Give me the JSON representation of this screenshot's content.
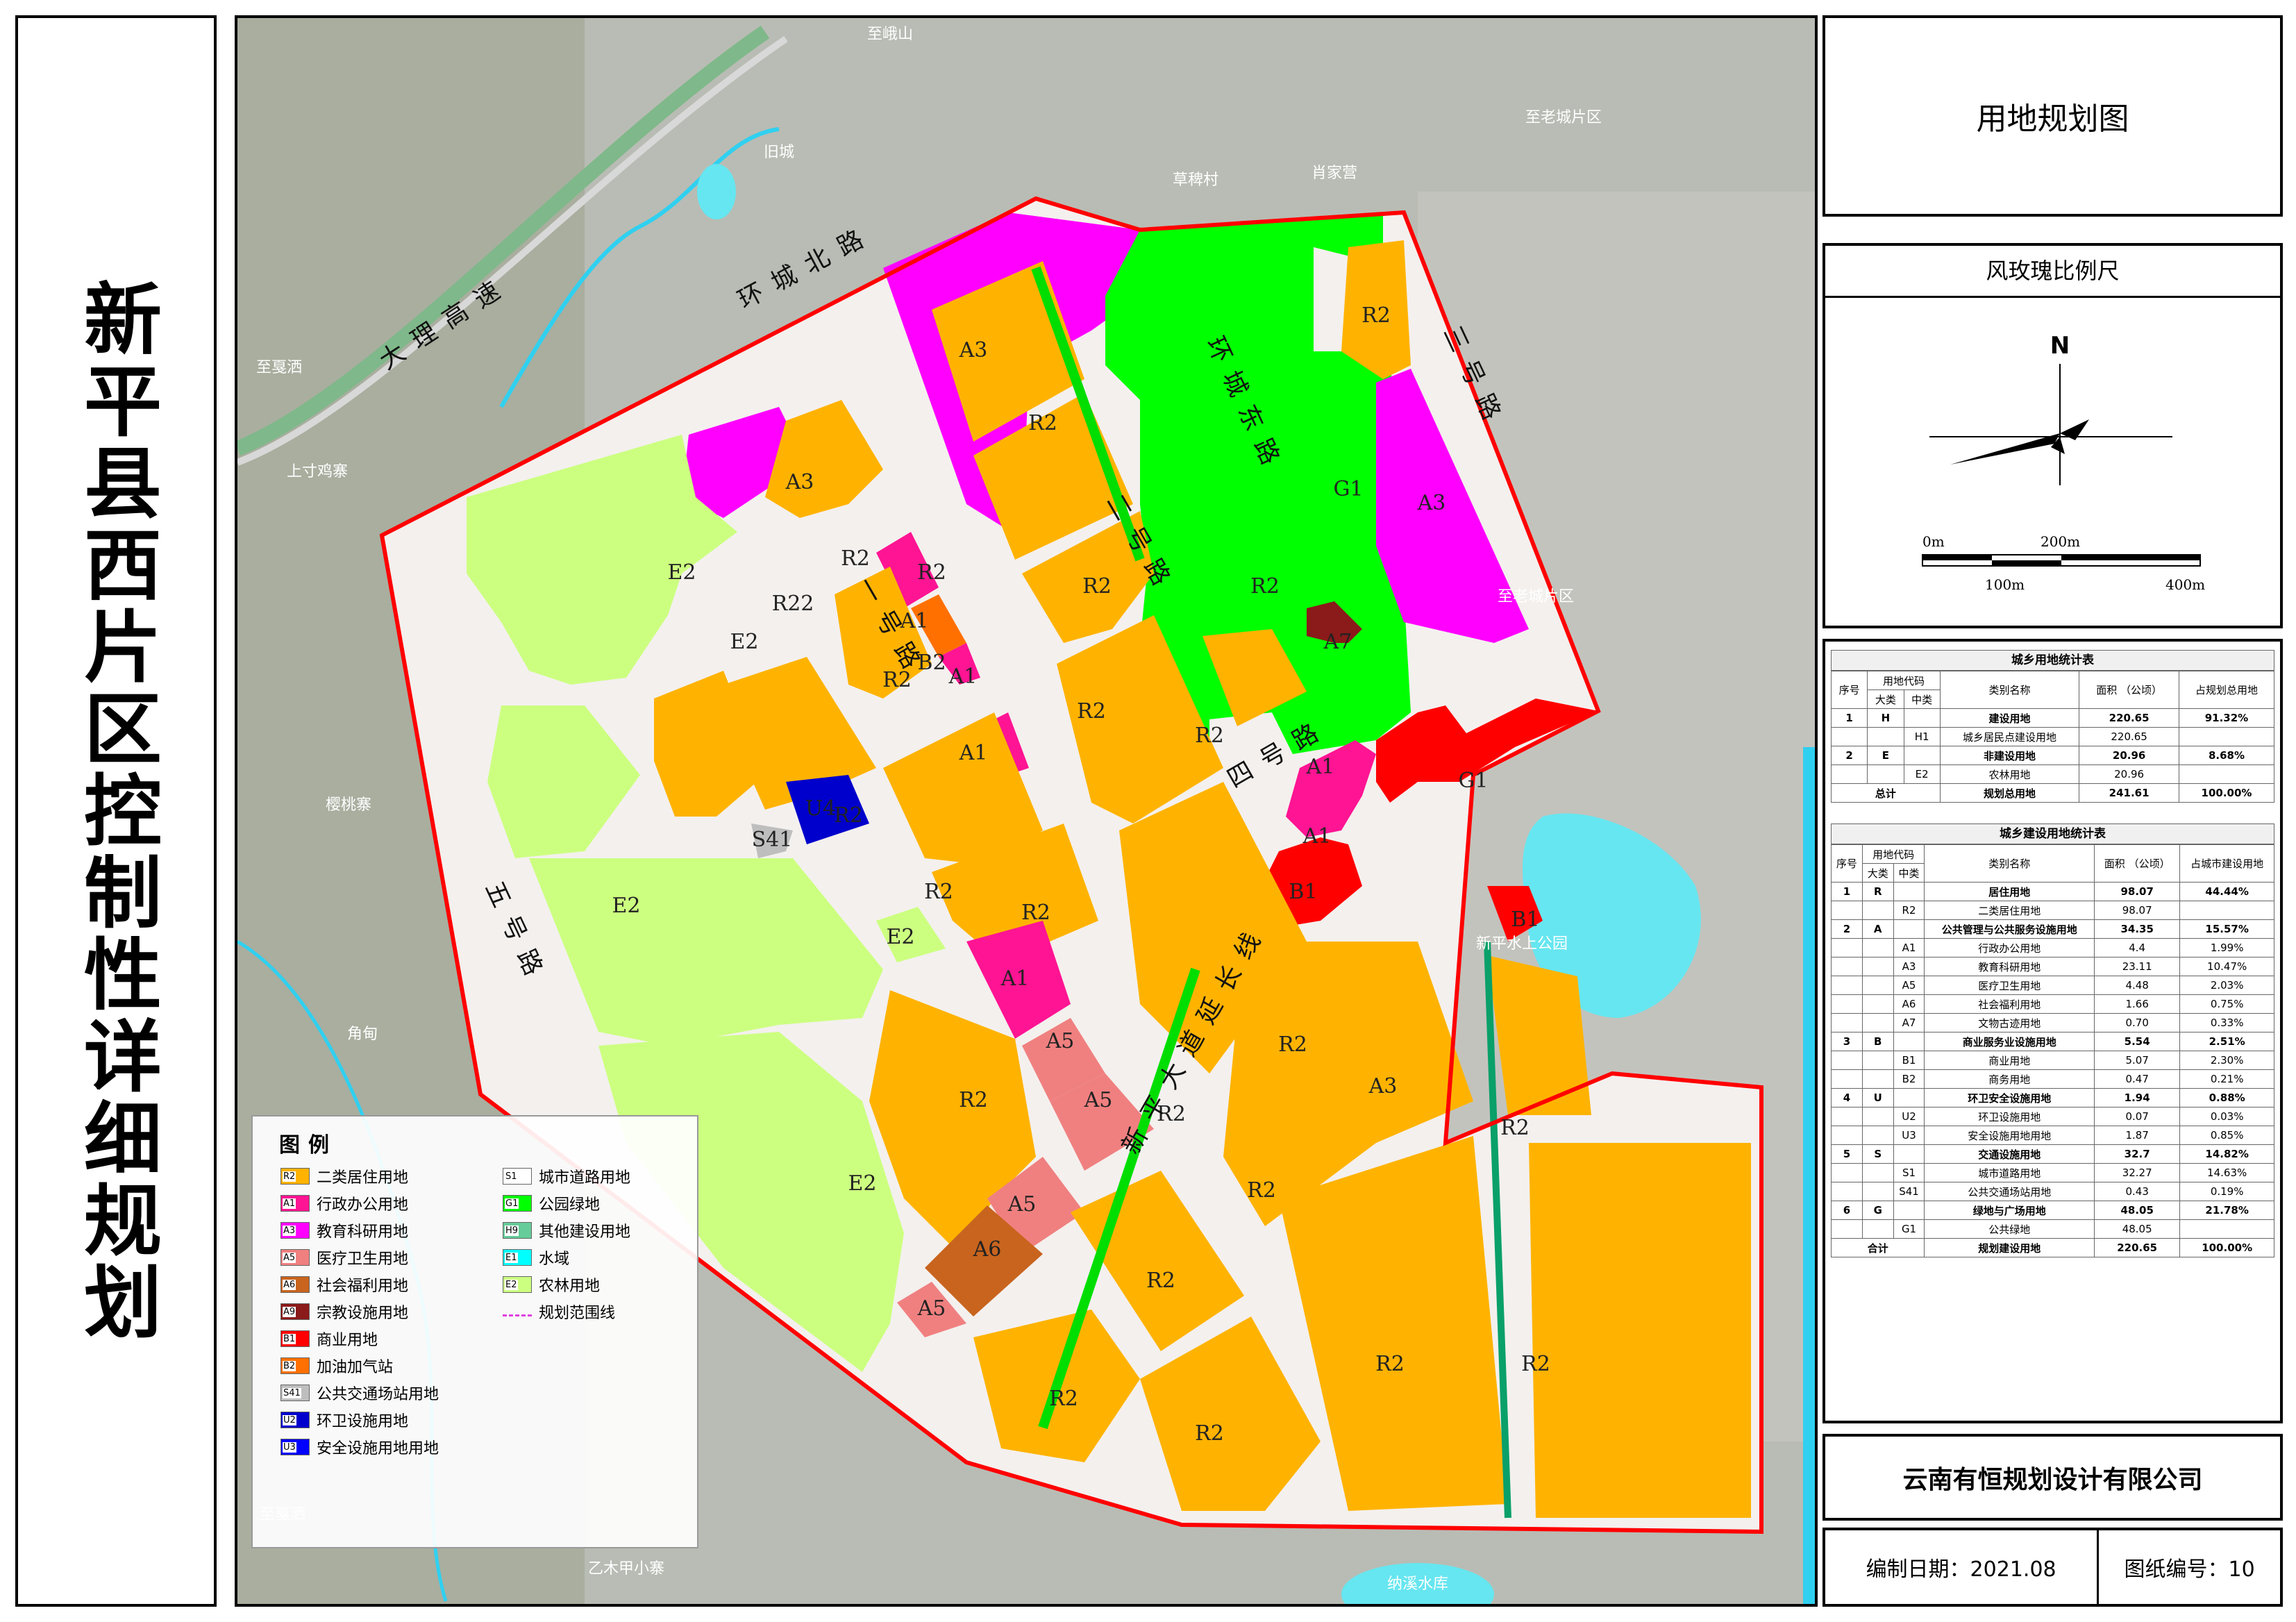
{
  "side_title": "新平县西片区控制性详细规划",
  "map_title": "用地规划图",
  "compass": {
    "header": "风玫瑰比例尺",
    "north": "N",
    "scale_labels": [
      "0m",
      "200m",
      "100m",
      "400m"
    ]
  },
  "stats1": {
    "caption": "城乡用地统计表",
    "headers": [
      "序号",
      "用地代码",
      "大类",
      "中类",
      "类别名称",
      "面积 （公顷）",
      "占规划总用地"
    ],
    "rows": [
      {
        "no": "1",
        "major": "H",
        "minor": "",
        "name": "建设用地",
        "area": "220.65",
        "pct": "91.32%",
        "bold": true
      },
      {
        "no": "",
        "major": "",
        "minor": "H1",
        "name": "城乡居民点建设用地",
        "area": "220.65",
        "pct": "",
        "bold": false
      },
      {
        "no": "2",
        "major": "E",
        "minor": "",
        "name": "非建设用地",
        "area": "20.96",
        "pct": "8.68%",
        "bold": true
      },
      {
        "no": "",
        "major": "",
        "minor": "E2",
        "name": "农林用地",
        "area": "20.96",
        "pct": "",
        "bold": false
      }
    ],
    "total": {
      "label": "总计",
      "name": "规划总用地",
      "area": "241.61",
      "pct": "100.00%"
    }
  },
  "stats2": {
    "caption": "城乡建设用地统计表",
    "headers": [
      "序号",
      "用地代码",
      "大类",
      "中类",
      "类别名称",
      "面积 （公顷）",
      "占城市建设用地"
    ],
    "rows": [
      {
        "no": "1",
        "major": "R",
        "minor": "",
        "name": "居住用地",
        "area": "98.07",
        "pct": "44.44%",
        "bold": true
      },
      {
        "no": "",
        "major": "",
        "minor": "R2",
        "name": "二类居住用地",
        "area": "98.07",
        "pct": "",
        "bold": false
      },
      {
        "no": "2",
        "major": "A",
        "minor": "",
        "name": "公共管理与公共服务设施用地",
        "area": "34.35",
        "pct": "15.57%",
        "bold": true
      },
      {
        "no": "",
        "major": "",
        "minor": "A1",
        "name": "行政办公用地",
        "area": "4.4",
        "pct": "1.99%",
        "bold": false
      },
      {
        "no": "",
        "major": "",
        "minor": "A3",
        "name": "教育科研用地",
        "area": "23.11",
        "pct": "10.47%",
        "bold": false
      },
      {
        "no": "",
        "major": "",
        "minor": "A5",
        "name": "医疗卫生用地",
        "area": "4.48",
        "pct": "2.03%",
        "bold": false
      },
      {
        "no": "",
        "major": "",
        "minor": "A6",
        "name": "社会福利用地",
        "area": "1.66",
        "pct": "0.75%",
        "bold": false
      },
      {
        "no": "",
        "major": "",
        "minor": "A7",
        "name": "文物古迹用地",
        "area": "0.70",
        "pct": "0.33%",
        "bold": false
      },
      {
        "no": "3",
        "major": "B",
        "minor": "",
        "name": "商业服务业设施用地",
        "area": "5.54",
        "pct": "2.51%",
        "bold": true
      },
      {
        "no": "",
        "major": "",
        "minor": "B1",
        "name": "商业用地",
        "area": "5.07",
        "pct": "2.30%",
        "bold": false
      },
      {
        "no": "",
        "major": "",
        "minor": "B2",
        "name": "商务用地",
        "area": "0.47",
        "pct": "0.21%",
        "bold": false
      },
      {
        "no": "4",
        "major": "U",
        "minor": "",
        "name": "环卫安全设施用地",
        "area": "1.94",
        "pct": "0.88%",
        "bold": true
      },
      {
        "no": "",
        "major": "",
        "minor": "U2",
        "name": "环卫设施用地",
        "area": "0.07",
        "pct": "0.03%",
        "bold": false
      },
      {
        "no": "",
        "major": "",
        "minor": "U3",
        "name": "安全设施用地用地",
        "area": "1.87",
        "pct": "0.85%",
        "bold": false
      },
      {
        "no": "5",
        "major": "S",
        "minor": "",
        "name": "交通设施用地",
        "area": "32.7",
        "pct": "14.82%",
        "bold": true
      },
      {
        "no": "",
        "major": "",
        "minor": "S1",
        "name": "城市道路用地",
        "area": "32.27",
        "pct": "14.63%",
        "bold": false
      },
      {
        "no": "",
        "major": "",
        "minor": "S41",
        "name": "公共交通场站用地",
        "area": "0.43",
        "pct": "0.19%",
        "bold": false
      },
      {
        "no": "6",
        "major": "G",
        "minor": "",
        "name": "绿地与广场用地",
        "area": "48.05",
        "pct": "21.78%",
        "bold": true
      },
      {
        "no": "",
        "major": "",
        "minor": "G1",
        "name": "公共绿地",
        "area": "48.05",
        "pct": "",
        "bold": false
      }
    ],
    "total": {
      "label": "合计",
      "name": "规划建设用地",
      "area": "220.65",
      "pct": "100.00%"
    }
  },
  "company": "云南有恒规划设计有限公司",
  "footer": {
    "date_label": "编制日期：2021.08",
    "sheet_label": "图纸编号：10"
  },
  "legend": {
    "title": "图例",
    "items": [
      {
        "code": "R2",
        "label": "二类居住用地",
        "color": "#FFB300"
      },
      {
        "code": "A1",
        "label": "行政办公用地",
        "color": "#FF1493"
      },
      {
        "code": "A3",
        "label": "教育科研用地",
        "color": "#FF00FF"
      },
      {
        "code": "A5",
        "label": "医疗卫生用地",
        "color": "#F08080"
      },
      {
        "code": "A6",
        "label": "社会福利用地",
        "color": "#C8641E"
      },
      {
        "code": "A9",
        "label": "宗教设施用地",
        "color": "#8B1A1A"
      },
      {
        "code": "B1",
        "label": "商业用地",
        "color": "#FF0000"
      },
      {
        "code": "B2",
        "label": "加油加气站",
        "color": "#FF7000"
      },
      {
        "code": "S41",
        "label": "公共交通场站用地",
        "color": "#BEBEBE"
      },
      {
        "code": "U2",
        "label": "环卫设施用地",
        "color": "#0000CC"
      },
      {
        "code": "U3",
        "label": "安全设施用地用地",
        "color": "#0000FF"
      },
      {
        "code": "S1",
        "label": "城市道路用地",
        "color": "#FFFFFF"
      },
      {
        "code": "G1",
        "label": "公园绿地",
        "color": "#00FF00"
      },
      {
        "code": "H9",
        "label": "其他建设用地",
        "color": "#66CC99"
      },
      {
        "code": "E1",
        "label": "水域",
        "color": "#00FFFF"
      },
      {
        "code": "E2",
        "label": "农林用地",
        "color": "#CCFF80"
      },
      {
        "code": "",
        "label": "规划范围线",
        "color": "#E040E0"
      }
    ]
  },
  "map_places": [
    "至峨山",
    "至老城片区",
    "至老城片区",
    "旧城",
    "至戛洒",
    "上寸鸡寨",
    "樱桃寨",
    "至戛洒",
    "新平水上公园",
    "纳溪水库",
    "乙木甲小寨",
    "草稗村",
    "肖家营",
    "角甸"
  ],
  "map_roads": [
    "大理高速",
    "环城北路",
    "一号路",
    "二号路",
    "三号路",
    "四号路",
    "新平大道延长线",
    "五号路",
    "环城东路"
  ],
  "parcels_labels": [
    "A3",
    "R2",
    "G1",
    "R2",
    "A3",
    "A3",
    "R2",
    "R22",
    "E2",
    "E2",
    "A1",
    "B2",
    "A1",
    "R2",
    "R2",
    "R2",
    "R2",
    "A1",
    "R2",
    "R2",
    "A7",
    "A1",
    "A1",
    "G1",
    "B1",
    "S41",
    "U4",
    "R2",
    "E2",
    "R2",
    "R2",
    "E2",
    "A1",
    "R2",
    "A5",
    "A5",
    "R2",
    "A3",
    "B1",
    "R2",
    "E2",
    "A5",
    "R2",
    "R2",
    "A6",
    "A5",
    "R2",
    "R2",
    "R2",
    "R2",
    "R2"
  ],
  "colors": {
    "R": "#FFB300",
    "A1": "#FF1493",
    "A3": "#FF00FF",
    "A5": "#F08080",
    "A6": "#C8641E",
    "A7": "#8B1A1A",
    "B1": "#FF0000",
    "B2": "#FF7000",
    "G1": "#00FF00",
    "E2": "#CCFF80",
    "U": "#0000CC",
    "S41": "#BEBEBE",
    "boundary": "#FF0000"
  }
}
